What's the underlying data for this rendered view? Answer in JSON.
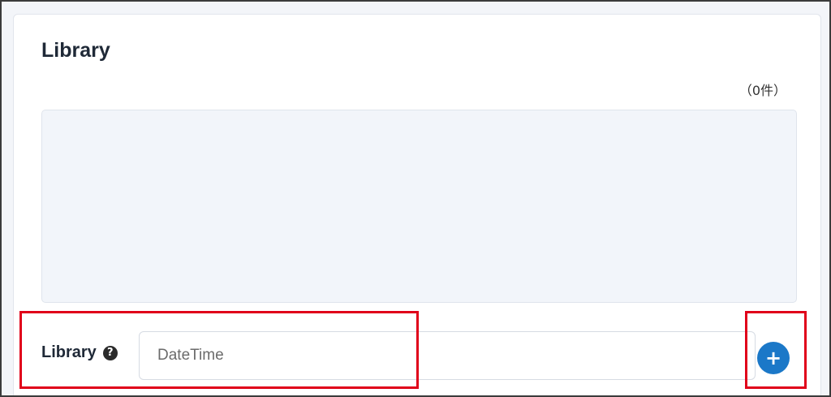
{
  "section": {
    "title": "Library",
    "count_text": "（0件）"
  },
  "field": {
    "label": "Library",
    "help_icon": "question-circle-icon",
    "help_glyph": "?",
    "input_placeholder": "DateTime",
    "input_value": ""
  },
  "add_button": {
    "icon": "plus-circle-icon",
    "glyph": "+"
  },
  "colors": {
    "accent": "#1b78c8",
    "highlight": "#e0001a",
    "list_bg": "#f2f5fa"
  }
}
